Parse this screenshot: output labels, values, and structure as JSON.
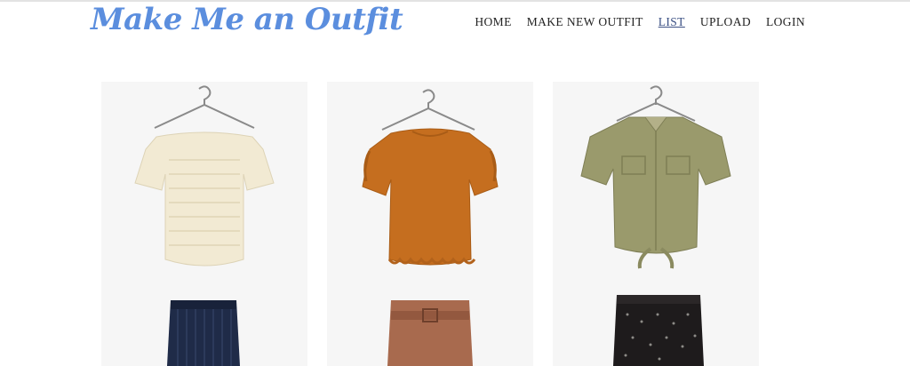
{
  "header": {
    "logo": "Make Me an Outfit",
    "nav": [
      {
        "label": "HOME"
      },
      {
        "label": "MAKE NEW OUTFIT"
      },
      {
        "label": "LIST",
        "active": true
      },
      {
        "label": "UPLOAD"
      },
      {
        "label": "LOGIN"
      }
    ]
  },
  "outfits": [
    {
      "top": "off-shoulder-cream-top",
      "top_color": "#f2ead3",
      "bottom": "navy-pinstripe-pants",
      "bottom_color": "#1f2b48"
    },
    {
      "top": "ruffle-rust-top",
      "top_color": "#c56e1f",
      "bottom": "belted-terracotta-shorts",
      "bottom_color": "#a86a4e"
    },
    {
      "top": "olive-tie-front-shirt",
      "top_color": "#9a9a6c",
      "bottom": "black-print-pants",
      "bottom_color": "#1e1b1c"
    }
  ]
}
